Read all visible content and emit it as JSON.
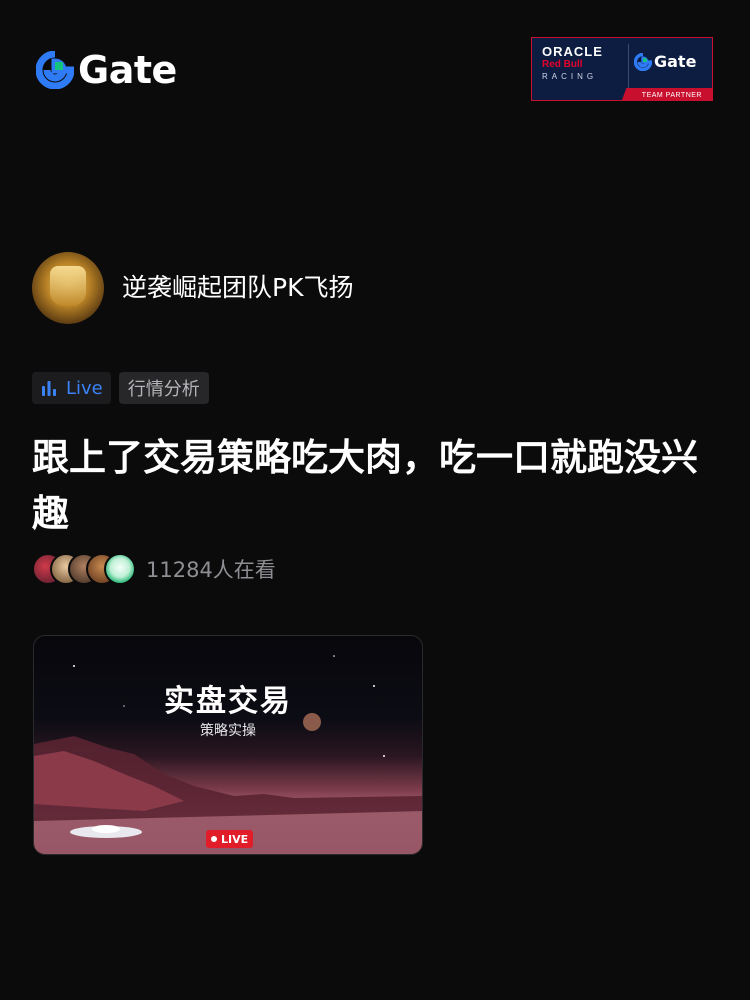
{
  "brand": {
    "logo_text": "Gate",
    "accent": "#2f7bf5",
    "green": "#14c37c"
  },
  "partner": {
    "oracle": "ORACLE",
    "redbull": "Red Bull",
    "racing": "RACING",
    "gate": "Gate",
    "team_partner": "TEAM PARTNER"
  },
  "author": {
    "name": "逆袭崛起团队PK飞扬"
  },
  "tags": {
    "live": "Live",
    "category": "行情分析"
  },
  "post": {
    "title": "跟上了交易策略吃大肉，吃一口就跑没兴趣"
  },
  "viewers": {
    "count_text": "11284人在看"
  },
  "cover": {
    "title": "实盘交易",
    "subtitle": "策略实操",
    "live_badge": "LIVE"
  }
}
